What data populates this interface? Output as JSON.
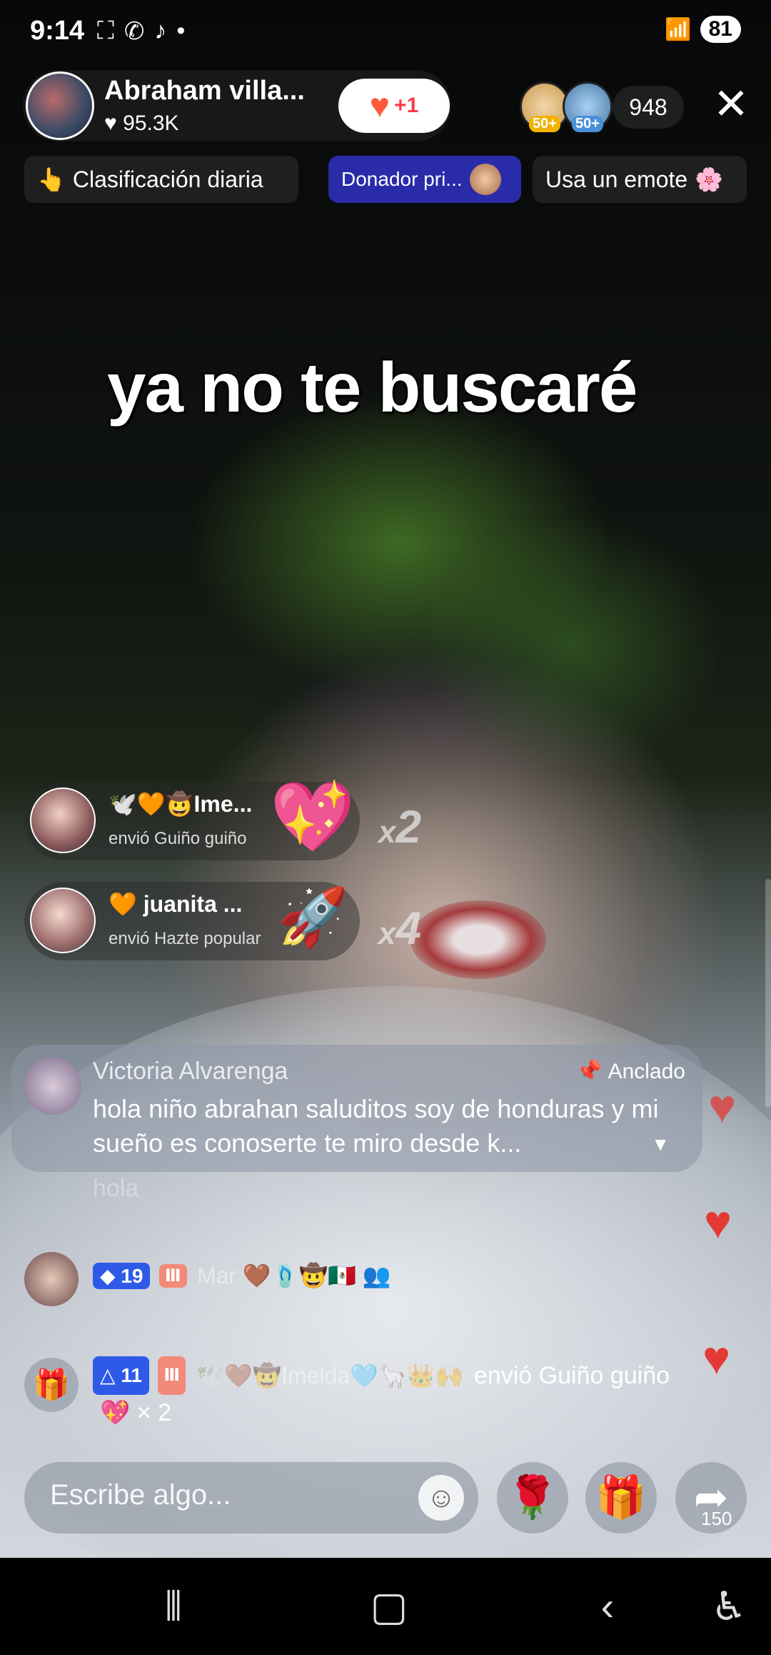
{
  "status_bar": {
    "time": "9:14",
    "left_icons": [
      "screenshot-icon",
      "whatsapp-icon",
      "tiktok-icon",
      "dot-icon"
    ],
    "battery": "81"
  },
  "host": {
    "name": "Abraham villa...",
    "likes": "95.3K",
    "follow_badge": "+1"
  },
  "viewers": {
    "badges": [
      "50+",
      "50+"
    ],
    "count": "948"
  },
  "chips": {
    "daily_rank": "Clasificación diaria",
    "top_donor": "Donador pri...",
    "use_emote": "Usa un emote"
  },
  "overlay_text": "ya no te buscaré",
  "gifts": [
    {
      "name": "🕊️🧡🤠Ime...",
      "sub": "envió Guiño guiño",
      "icon": "💖",
      "combo_prefix": "x",
      "combo_count": "2"
    },
    {
      "name": "🧡 juanita ...",
      "sub": "envió Hazte popular",
      "icon": "🚀",
      "combo_prefix": "x",
      "combo_count": "4"
    }
  ],
  "pinned": {
    "name": "Victoria Alvarenga",
    "label": "Anclado",
    "text": "hola niño abrahan saluditos soy de honduras y mi sueño es conoserte te miro desde k..."
  },
  "ghost_text": "hola",
  "chat": [
    {
      "level": "19",
      "name": "Mar",
      "emojis": "🤎🩴🤠🇲🇽",
      "text": ""
    },
    {
      "level": "11",
      "name": "🕊️🤎🤠Imelda🩵🦙👑🙌",
      "text": "envió Guiño guiño",
      "suffix": "💖 × 2"
    }
  ],
  "input": {
    "placeholder": "Escribe algo..."
  },
  "share_count": "150",
  "colors": {
    "accent_blue": "#2f5ae8",
    "heart_red": "#e53935",
    "donor_chip": "#2a2ba8"
  }
}
